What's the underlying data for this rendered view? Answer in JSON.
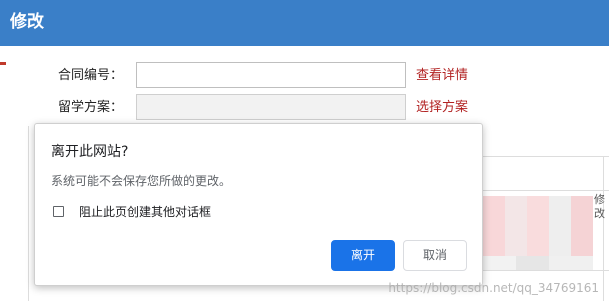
{
  "window": {
    "title": "修改"
  },
  "form": {
    "contract_no": {
      "label": "合同编号：",
      "value": "",
      "link": "查看详情"
    },
    "study_plan": {
      "label": "留学方案：",
      "value": "",
      "link": "选择方案"
    }
  },
  "background": {
    "partial_text": "修改"
  },
  "dialog": {
    "title": "离开此网站?",
    "message": "系统可能不会保存您所做的更改。",
    "checkbox_label": "阻止此页创建其他对话框",
    "checkbox_checked": false,
    "leave_label": "离开",
    "cancel_label": "取消"
  },
  "watermark": "https://blog.csdn.net/qq_34769161",
  "colors": {
    "titlebar": "#3a7fc8",
    "link": "#b22222",
    "primary_button": "#1a73e8"
  }
}
